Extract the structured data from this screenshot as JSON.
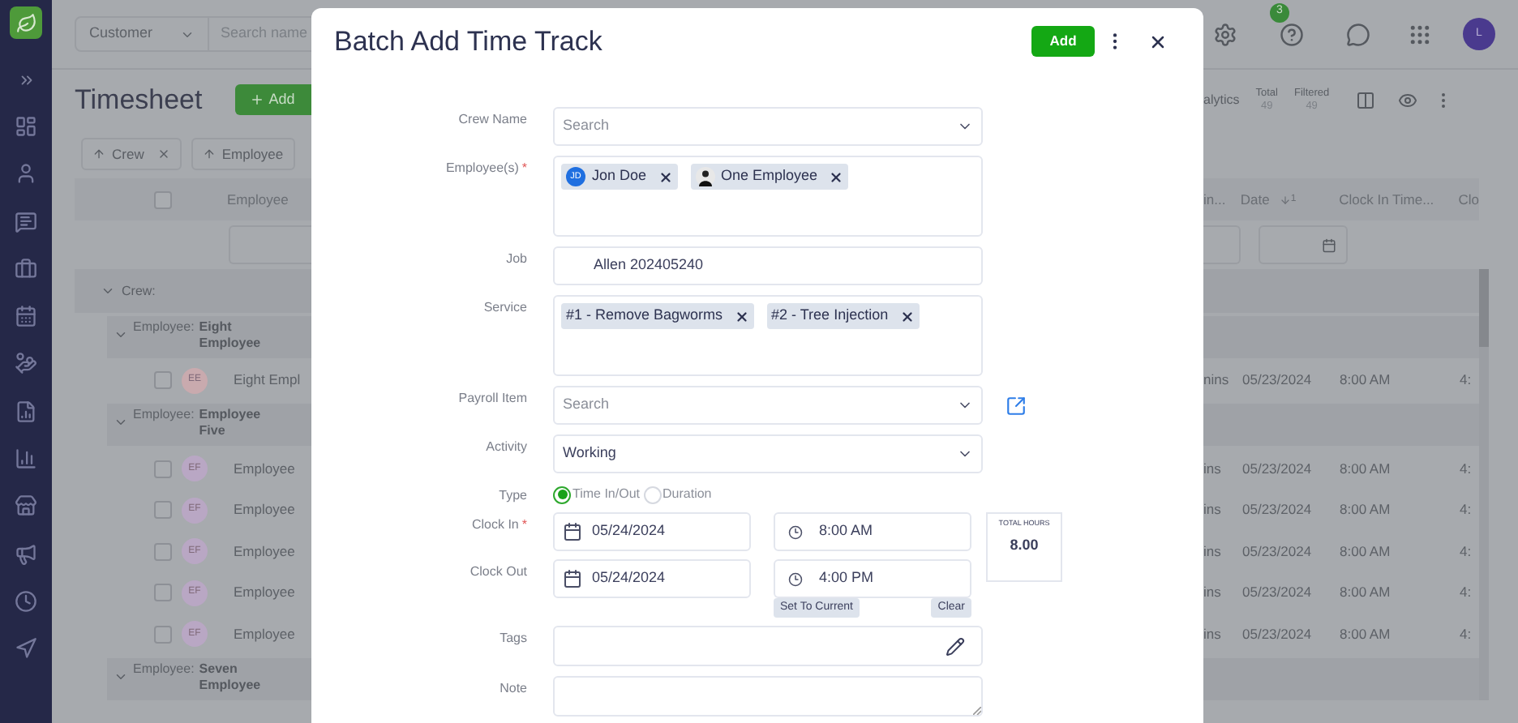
{
  "background": {
    "header": {
      "filter_select": "Customer",
      "search_placeholder": "Search name",
      "notification_count": "3",
      "avatar": "L"
    },
    "page_title": "Timesheet",
    "add_button": "Add",
    "toolbar": {
      "analytics": "alytics",
      "stats": [
        {
          "label": "Total",
          "value": "49"
        },
        {
          "label": "Filtered",
          "value": "49"
        }
      ]
    },
    "sort_chips": [
      {
        "label": "Crew",
        "removable": true
      },
      {
        "label": "Employee",
        "removable": false
      }
    ],
    "table": {
      "left_header": "Employee",
      "select_all_checked": false,
      "right_headers": [
        {
          "label": "in..."
        },
        {
          "label": "Date",
          "sort_order": "1"
        },
        {
          "label": "Clock In Time..."
        },
        {
          "label": "Clo"
        }
      ],
      "rows": [
        {
          "kind": "crew",
          "label": "Crew:"
        },
        {
          "kind": "group",
          "label": "Employee:",
          "value": "Eight Employee"
        },
        {
          "kind": "entry",
          "checked": false,
          "initials": "EE",
          "color": "#c9aaae",
          "name": "Eight Empl",
          "duration": "nins",
          "date": "05/23/2024",
          "clock_in": "8:00 AM",
          "clock_out": "4:"
        },
        {
          "kind": "group",
          "label": "Employee:",
          "value": "Employee Five"
        },
        {
          "kind": "entry",
          "checked": false,
          "initials": "EF",
          "color": "#b9a7c4",
          "name": "Employee",
          "duration": "ins",
          "date": "05/23/2024",
          "clock_in": "8:00 AM",
          "clock_out": "4:"
        },
        {
          "kind": "entry",
          "checked": false,
          "initials": "EF",
          "color": "#b9a7c4",
          "name": "Employee",
          "duration": "ins",
          "date": "05/23/2024",
          "clock_in": "8:00 AM",
          "clock_out": "4:"
        },
        {
          "kind": "entry",
          "checked": false,
          "initials": "EF",
          "color": "#b9a7c4",
          "name": "Employee",
          "duration": "ins",
          "date": "05/23/2024",
          "clock_in": "8:00 AM",
          "clock_out": "4:"
        },
        {
          "kind": "entry",
          "checked": false,
          "initials": "EF",
          "color": "#b9a7c4",
          "name": "Employee",
          "duration": "ins",
          "date": "05/23/2024",
          "clock_in": "8:00 AM",
          "clock_out": "4:"
        },
        {
          "kind": "entry",
          "checked": false,
          "initials": "EF",
          "color": "#b9a7c4",
          "name": "Employee",
          "duration": "ins",
          "date": "05/23/2024",
          "clock_in": "8:00 AM",
          "clock_out": "4:"
        },
        {
          "kind": "group",
          "label": "Employee:",
          "value": "Seven Employee"
        }
      ]
    }
  },
  "dialog": {
    "title": "Batch Add Time Track",
    "add_button": "Add",
    "fields": [
      {
        "kind": "select",
        "label": "Crew Name",
        "placeholder": "Search"
      },
      {
        "kind": "tags",
        "label": "Employee(s)",
        "required_mark": "*",
        "tags": [
          {
            "label": "Jon Doe",
            "avatar": {
              "kind": "initials",
              "text": "JD"
            }
          },
          {
            "label": "One Employee"
          }
        ]
      },
      {
        "kind": "text",
        "label": "Job",
        "value": "Allen 202405240"
      },
      {
        "kind": "tags",
        "label": "Service",
        "tags": [
          {
            "label": "#1 - Remove Bagworms"
          },
          {
            "label": "#2 - Tree Injection"
          }
        ]
      },
      {
        "kind": "select",
        "label": "Payroll Item",
        "placeholder": "Search",
        "link": true
      },
      {
        "kind": "select",
        "label": "Activity",
        "value": "Working"
      },
      {
        "kind": "radio",
        "label": "Type",
        "options": [
          {
            "label": "Time In/Out",
            "selected": true
          },
          {
            "label": "Duration",
            "selected": false
          }
        ]
      }
    ],
    "clock": {
      "rows": [
        {
          "label": "Clock In",
          "required_mark": "*",
          "date": "05/24/2024",
          "time": "8:00 AM"
        },
        {
          "label": "Clock Out",
          "date": "05/24/2024",
          "time": "4:00 PM",
          "actions": [
            "Set To Current",
            "Clear"
          ]
        }
      ],
      "total_hours": {
        "label": "TOTAL HOURS",
        "value": "8.00"
      }
    },
    "fields_after": [
      {
        "kind": "tag_input",
        "label": "Tags"
      },
      {
        "kind": "textarea",
        "label": "Note"
      }
    ]
  }
}
